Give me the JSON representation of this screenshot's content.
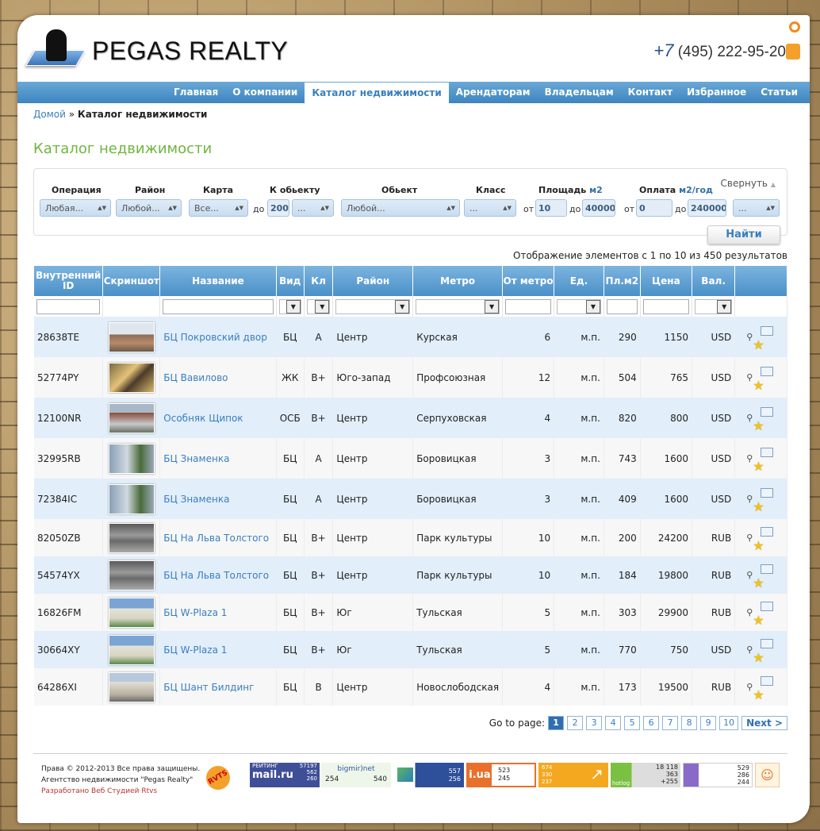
{
  "header": {
    "logo_text": "PEGAS REALTY",
    "phone_code": "+7",
    "phone_number": "(495) 222-95-20"
  },
  "nav": [
    {
      "label": "Главная",
      "active": false
    },
    {
      "label": "О компании",
      "active": false
    },
    {
      "label": "Каталог недвижимости",
      "active": true
    },
    {
      "label": "Арендаторам",
      "active": false
    },
    {
      "label": "Владельцам",
      "active": false
    },
    {
      "label": "Контакт",
      "active": false
    },
    {
      "label": "Избранное",
      "active": false
    },
    {
      "label": "Статьи",
      "active": false
    }
  ],
  "breadcrumb": {
    "home": "Домой",
    "sep": "»",
    "current": "Каталог недвижимости"
  },
  "page_title": "Каталог недвижимости",
  "filter": {
    "labels": {
      "operation": "Операция",
      "district": "Район",
      "map": "Карта",
      "to_object": "К обьекту",
      "object": "Обьект",
      "class": "Класс",
      "area": "Площадь",
      "area_unit": "м2",
      "payment": "Оплата",
      "payment_unit": "м2/год"
    },
    "values": {
      "operation": "Любая...",
      "district": "Любой...",
      "map": "Все...",
      "to_object_num": "200",
      "to_object_sel": "...",
      "object": "Любой...",
      "class": "...",
      "area_from": "10",
      "area_to": "40000",
      "pay_from": "0",
      "pay_to": "240000",
      "pay_sel": "..."
    },
    "from_label": "от",
    "to_label": "до",
    "collapse": "Свернуть",
    "find": "Найти"
  },
  "summary": "Отображение элементов с 1 по 10 из 450 результатов",
  "table": {
    "headers": [
      "Внутренний ID",
      "Скриншот",
      "Название",
      "Вид",
      "Кл",
      "Район",
      "Метро",
      "От метро",
      "Ед.",
      "Пл.м2",
      "Цена",
      "Вал."
    ],
    "rows": [
      {
        "id": "28638TE",
        "name": "БЦ Покровский двор",
        "type": "БЦ",
        "cls": "A",
        "district": "Центр",
        "metro": "Курская",
        "dist": "6",
        "unit": "м.п.",
        "area": "290",
        "price": "1150",
        "cur": "USD"
      },
      {
        "id": "52774PY",
        "name": "БЦ Вавилово",
        "type": "ЖК",
        "cls": "B+",
        "district": "Юго-запад",
        "metro": "Профсоюзная",
        "dist": "12",
        "unit": "м.п.",
        "area": "504",
        "price": "765",
        "cur": "USD"
      },
      {
        "id": "12100NR",
        "name": "Особняк Щипок",
        "type": "ОСБ",
        "cls": "B+",
        "district": "Центр",
        "metro": "Серпуховская",
        "dist": "4",
        "unit": "м.п.",
        "area": "820",
        "price": "800",
        "cur": "USD"
      },
      {
        "id": "32995RB",
        "name": "БЦ Знаменка",
        "type": "БЦ",
        "cls": "A",
        "district": "Центр",
        "metro": "Боровицкая",
        "dist": "3",
        "unit": "м.п.",
        "area": "743",
        "price": "1600",
        "cur": "USD"
      },
      {
        "id": "72384IC",
        "name": "БЦ Знаменка",
        "type": "БЦ",
        "cls": "A",
        "district": "Центр",
        "metro": "Боровицкая",
        "dist": "3",
        "unit": "м.п.",
        "area": "409",
        "price": "1600",
        "cur": "USD"
      },
      {
        "id": "82050ZB",
        "name": "БЦ На Льва Толстого",
        "type": "БЦ",
        "cls": "B+",
        "district": "Центр",
        "metro": "Парк культуры",
        "dist": "10",
        "unit": "м.п.",
        "area": "200",
        "price": "24200",
        "cur": "RUB"
      },
      {
        "id": "54574YX",
        "name": "БЦ На Льва Толстого",
        "type": "БЦ",
        "cls": "B+",
        "district": "Центр",
        "metro": "Парк культуры",
        "dist": "10",
        "unit": "м.п.",
        "area": "184",
        "price": "19800",
        "cur": "RUB"
      },
      {
        "id": "16826FM",
        "name": "БЦ W-Plaza 1",
        "type": "БЦ",
        "cls": "B+",
        "district": "Юг",
        "metro": "Тульская",
        "dist": "5",
        "unit": "м.п.",
        "area": "303",
        "price": "29900",
        "cur": "RUB"
      },
      {
        "id": "30664XY",
        "name": "БЦ W-Plaza 1",
        "type": "БЦ",
        "cls": "B+",
        "district": "Юг",
        "metro": "Тульская",
        "dist": "5",
        "unit": "м.п.",
        "area": "770",
        "price": "750",
        "cur": "USD"
      },
      {
        "id": "64286XI",
        "name": "БЦ Шант Билдинг",
        "type": "БЦ",
        "cls": "B",
        "district": "Центр",
        "metro": "Новослободская",
        "dist": "4",
        "unit": "м.п.",
        "area": "173",
        "price": "19500",
        "cur": "RUB"
      }
    ]
  },
  "pager": {
    "label": "Go to page:",
    "pages": [
      "1",
      "2",
      "3",
      "4",
      "5",
      "6",
      "7",
      "8",
      "9",
      "10"
    ],
    "current": "1",
    "next": "Next >"
  },
  "footer": {
    "copyright": "Права © 2012-2013 Все права защищены.",
    "agency": "Агентство недвижимости \"Pegas Realty\"",
    "developer": "Разработано Веб Студией Rtvs",
    "rvts_logo": "RVTS",
    "counters": {
      "mail_title": "РЕЙТИНГ",
      "mail_brand": "mail.ru",
      "mail_n": [
        "57197",
        "562",
        "260"
      ],
      "bigmir_brand": "bigmir)net",
      "bigmir_n": [
        "254",
        "540"
      ],
      "c3_n": [
        "557",
        "256"
      ],
      "iua_brand": "i.ua",
      "iua_n": [
        "523",
        "245"
      ],
      "c5_n": [
        "674",
        "330",
        "237"
      ],
      "hotlog_brand": "hotlog",
      "hotlog_n": [
        "18 118",
        "363",
        "+255"
      ],
      "c7_n": [
        "529",
        "286",
        "244"
      ]
    }
  }
}
